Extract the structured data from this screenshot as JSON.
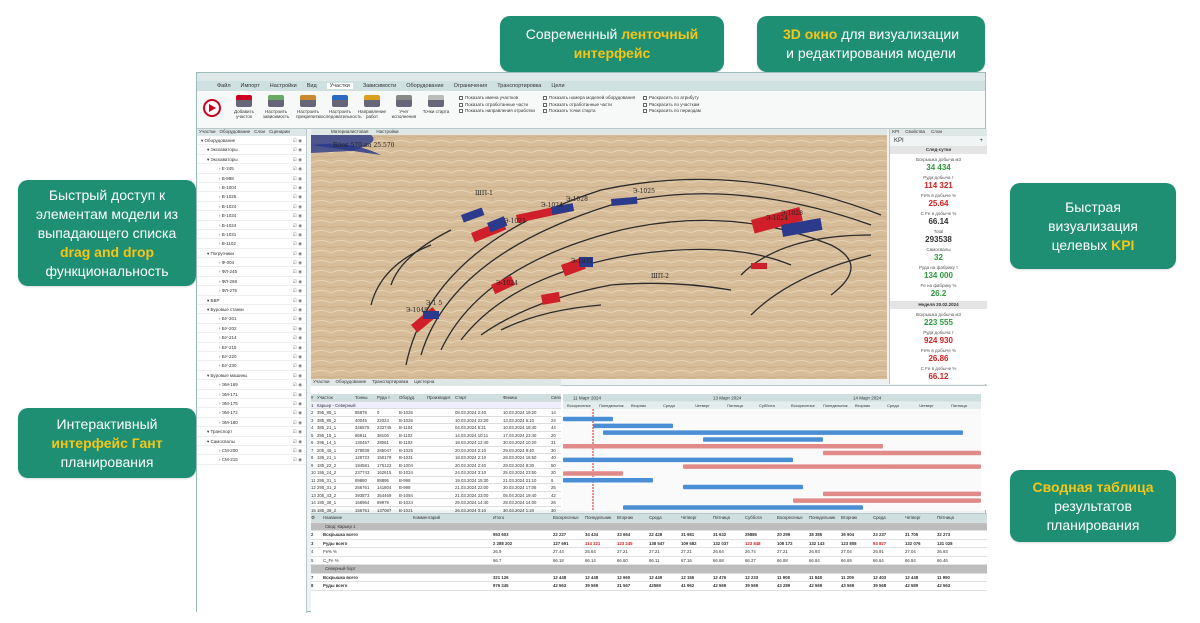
{
  "callouts": {
    "ribbon": {
      "line1": "Современный",
      "hl": "ленточный",
      "line2": "интерфейс"
    },
    "window3d": {
      "hl": "3D окно",
      "line1": "для визуализации",
      "line2": "и редактирования модели"
    },
    "dragdrop": {
      "line1": "Быстрый доступ к",
      "line2": "элементам модели из",
      "line3": "выпадающего списка",
      "hl": "drag and drop",
      "line4": "функциональность"
    },
    "kpi": {
      "line1": "Быстрая",
      "line2": "визуализация",
      "line3": "целевых",
      "hl": "KPI"
    },
    "gantt": {
      "line1": "Интерактивный",
      "hl": "интерфейс Гант",
      "line2": "планирования"
    },
    "summary": {
      "hl": "Сводная таблица",
      "line1": "результатов",
      "line2": "планирования"
    }
  },
  "app": {
    "menu": [
      "Файл",
      "Импорт",
      "Настройки",
      "Вид",
      "Участки",
      "Зависимости",
      "Оборудование",
      "Ограничения",
      "Транспортировка",
      "Цели"
    ],
    "active_menu": "Участки",
    "ribbon_buttons": [
      "Добавить участок",
      "Настроить зависимость",
      "Настроить прекрепить",
      "Настроить последовательность",
      "Направление работ",
      "Учет исполнения",
      "Точки старта"
    ],
    "checks_col1": [
      "Показать имена участков",
      "Показать отработанные части",
      "Показать направления отработки"
    ],
    "checks_col2": [
      "Показать номера моделей оборудования",
      "Показать отработанные части",
      "Показать точки старта"
    ],
    "checks_col3": [
      "Раскрасить по атрибуту",
      "Раскрасить по участкам",
      "Раскрасить по периодам"
    ],
    "left_tabs": [
      "Участки",
      "Оборудование",
      "Слои",
      "Сценарии"
    ],
    "tree": [
      "Оборудование",
      "Экскаваторы",
      "Экскаваторы",
      "Е-245",
      "В-998",
      "В-1004",
      "В-1026",
      "В-1024",
      "В-1034",
      "В-1024",
      "В-1031",
      "В-1102",
      "Погрузчики",
      "Ф-004",
      "ФЛ-245",
      "ФЛ-268",
      "ФЛ-275",
      "БВР",
      "Буровые станки",
      "БУ-201",
      "БУ-202",
      "БУ-214",
      "БУ-215",
      "БУ-220",
      "БУ-230",
      "Буровые машины",
      "ЭМ-169",
      "ЭМ-171",
      "ЭМ-175",
      "ЭМ-172",
      "ЭМ-180",
      "Транспорт",
      "Самосвалы",
      "СМ-200",
      "СМ-215"
    ],
    "view_tabs": [
      "Материалистовая",
      "Настройки"
    ],
    "model_labels": [
      "Э-1024",
      "Э-1025",
      "ШП-1",
      "Э-1021",
      "Э-1031",
      "Э-1028",
      "Э-1024",
      "Э-1028",
      "ШП-2",
      "Э-1024",
      "Э-1048",
      "Э-1 5"
    ],
    "top_label": "Блок 570-на 25.570",
    "kpi_tabs": [
      "KPI",
      "Свойства",
      "Слои"
    ],
    "kpi_title": "KPI",
    "kpi_section1": "След-сутки",
    "kpi_items": [
      {
        "label": "Вскрышка добыча м3",
        "value": "34 434",
        "color": "#2a9a3a"
      },
      {
        "label": "Руда добыча т",
        "value": "114 321",
        "color": "#d02020"
      },
      {
        "label": "Fe% в добыче %",
        "value": "25.64",
        "color": "#d02020"
      },
      {
        "label": "C Fe в добыче %",
        "value": "66.14",
        "color": "#333333"
      },
      {
        "label": "Total",
        "value": "293538",
        "color": "#333333"
      },
      {
        "label": "Самосвалы",
        "value": "32",
        "color": "#2a9a3a"
      },
      {
        "label": "Руда на фабрику т",
        "value": "134 000",
        "color": "#2a9a3a"
      },
      {
        "label": "Fe на фабрику %",
        "value": "26.2",
        "color": "#2a9a3a"
      }
    ],
    "kpi_section2": "Неделя 20.02.2024",
    "kpi_items2": [
      {
        "label": "Вскрышка добыча м3",
        "value": "223 555",
        "color": "#2a9a3a"
      },
      {
        "label": "Руда добыча т",
        "value": "924 930",
        "color": "#d02020"
      },
      {
        "label": "Fe% в добыче %",
        "value": "26.86",
        "color": "#d02020"
      },
      {
        "label": "C Fe в добыче %",
        "value": "66.12",
        "color": "#d02020"
      },
      {
        "label": "Total",
        "value": "",
        "color": "#333333"
      }
    ],
    "gantt_tabs": [
      "Участки",
      "Оборудование",
      "Транспортировка",
      "Цистерна"
    ],
    "gantt_headers": [
      "Участок",
      "Тонны",
      "Руда т",
      "Оборуд.",
      "Производит.",
      "Старт",
      "Финиш",
      "Связь"
    ],
    "gantt_rows": [
      [
        "Карьер - Северный",
        "",
        "",
        "",
        "",
        "",
        "",
        ""
      ],
      [
        "395_85_1",
        "85878",
        "0",
        "В-1026",
        "",
        "08.03.2024 2:40",
        "10.03.2024 19:20",
        "14"
      ],
      [
        "385_85_2",
        "40045",
        "22024",
        "В-1026",
        "",
        "10.03.2024 22:20",
        "13.03.2024 6:10",
        "24"
      ],
      [
        "385_21_1",
        "346575",
        "233745",
        "В-1104",
        "",
        "04.03.2024 6:21",
        "10.03.2024 18:40",
        "44"
      ],
      [
        "295_15_1",
        "86911",
        "38106",
        "В-1102",
        "",
        "14.03.2024 10:11",
        "17.03.2024 23:40",
        "20"
      ],
      [
        "295_14_1",
        "130457",
        "28061",
        "В-1102",
        "",
        "18.03.2024 12:40",
        "30.03.2024 10:20",
        "31"
      ],
      [
        "205_45_1",
        "378839",
        "285047",
        "В-1025",
        "",
        "20.03.2024 2:10",
        "29.03.2024 9:40",
        "30"
      ],
      [
        "185_21_1",
        "128723",
        "150179",
        "В-1031",
        "",
        "18.03.2024 2:10",
        "28.03.2024 16:50",
        "40"
      ],
      [
        "185_22_2",
        "194581",
        "175122",
        "В-1004",
        "",
        "20.03.2024 2:40",
        "29.03.2024 8:30",
        "50"
      ],
      [
        "195_24_2",
        "237743",
        "162615",
        "В-1024",
        "",
        "24.03.2024 3:10",
        "25.03.2024 23:50",
        "20"
      ],
      [
        "295_31_1",
        "89880",
        "88895",
        "В-998",
        "",
        "19.03.2024 15:30",
        "21.03.2024 21:10",
        "9"
      ],
      [
        "295_31_2",
        "256761",
        "141804",
        "В-998",
        "",
        "21.03.2024 22:00",
        "30.03.2024 17:05",
        "25"
      ],
      [
        "205_43_2",
        "393873",
        "354469",
        "В-1094",
        "",
        "21.03.2024 23:00",
        "05.04.2024 19:40",
        "42"
      ],
      [
        "195_38_1",
        "168964",
        "89979",
        "В-1024",
        "",
        "29.03.2024 14:40",
        "28.03.2024 14:00",
        "26"
      ],
      [
        "185_38_2",
        "156751",
        "137087",
        "В-1021",
        "",
        "26.03.2024 3:10",
        "30.03.2024 1:20",
        "30"
      ]
    ],
    "gantt_dates": [
      "11 Март 2024",
      "13 Март 2024",
      "14 Март 2024"
    ],
    "gantt_days": [
      "Воскресенье",
      "Понедельник",
      "Вторник",
      "Среда",
      "Четверг",
      "Пятница",
      "Суббота",
      "Воскресенье",
      "Понедельник",
      "Вторник",
      "Среда",
      "Четверг",
      "Пятница"
    ],
    "summary_headers": [
      "Название",
      "Комментарий",
      "Итого",
      "Воскресенье",
      "Понедельник",
      "Вторник",
      "Среда",
      "Четверг",
      "Пятница",
      "Суббота",
      "Воскресенье",
      "Понедельник",
      "Вторник",
      "Среда",
      "Четверг",
      "Пятница"
    ],
    "summary_group1": "Свод: Карьер 1",
    "summary_rows": [
      [
        "Вскрышка всего",
        "",
        "953 603",
        "22 227",
        "34 434",
        "33 664",
        "22 428",
        "31 981",
        "31 632",
        "29886",
        "20 299",
        "38 385",
        "36 904",
        "23 237",
        "31 705",
        "32 273"
      ],
      [
        "Руды всего",
        "",
        "2 288 202",
        "127 691",
        "114 321",
        "123 245",
        "138 547",
        "109 582",
        "132 037",
        "123 848",
        "108 172",
        "132 143",
        "123 808",
        "93 827",
        "132 076",
        "131 028"
      ],
      [
        "Fe% %",
        "",
        "26.9",
        "27.44",
        "25.64",
        "27.21",
        "27.21",
        "27.21",
        "26.64",
        "26.74",
        "27.21",
        "26.93",
        "27.04",
        "25.91",
        "27.04",
        "26.93"
      ],
      [
        "C_Fe %",
        "",
        "66.7",
        "66.18",
        "66.14",
        "66.60",
        "66.11",
        "67.16",
        "66.68",
        "66.27",
        "66.88",
        "66.84",
        "66.69",
        "66.64",
        "66.84",
        "66.46"
      ]
    ],
    "summary_group2": "Северный борт",
    "summary_rows2": [
      [
        "Вскрышка всего",
        "",
        "321 126",
        "12 448",
        "12 448",
        "12 660",
        "12 449",
        "12 156",
        "12 476",
        "12 233",
        "11 908",
        "11 848",
        "11 209",
        "12 403",
        "12 448",
        "11 990"
      ],
      [
        "Руды всего",
        "",
        "976 245",
        "42 563",
        "39 569",
        "31 567",
        "42569",
        "41 962",
        "42 569",
        "39 569",
        "43 289",
        "42 569",
        "43 569",
        "39 568",
        "42 589",
        "42 563"
      ]
    ],
    "zoom_label": "Zoom"
  }
}
